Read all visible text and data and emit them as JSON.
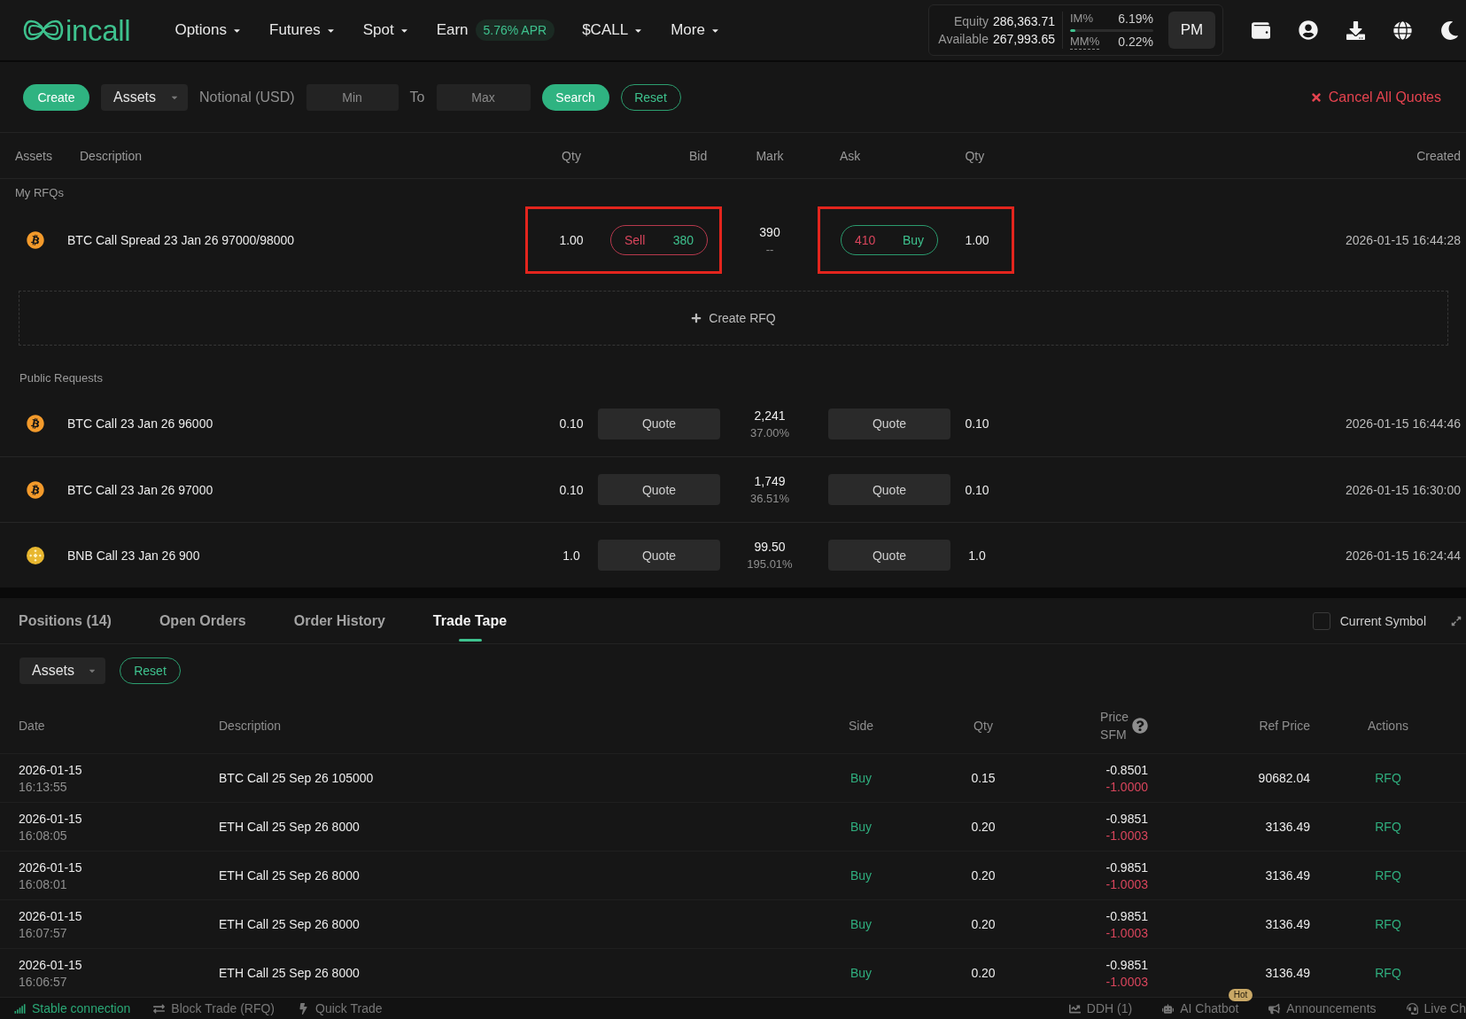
{
  "nav": {
    "logo": "incall",
    "menu": [
      {
        "label": "Options",
        "dropdown": true
      },
      {
        "label": "Futures",
        "dropdown": true
      },
      {
        "label": "Spot",
        "dropdown": true
      },
      {
        "label": "Earn",
        "dropdown": false,
        "badge": "5.76% APR"
      },
      {
        "label": "$CALL",
        "dropdown": true
      },
      {
        "label": "More",
        "dropdown": true
      }
    ],
    "account": {
      "equity_label": "Equity",
      "equity": "286,363.71",
      "available_label": "Available",
      "available": "267,993.65",
      "margins": [
        {
          "label": "IM%",
          "value": "6.19%",
          "tooltip": false,
          "level": 0.0619
        },
        {
          "label": "MM%",
          "value": "0.22%",
          "tooltip": true
        }
      ],
      "mode": "PM"
    }
  },
  "rfq_filters": {
    "create": "Create",
    "assets": "Assets",
    "notional_label": "Notional (USD)",
    "min": {
      "placeholder": "Min"
    },
    "to_label": "To",
    "max": {
      "placeholder": "Max"
    },
    "search": "Search",
    "reset": "Reset",
    "cancel_all": "Cancel All Quotes"
  },
  "rfq_table": {
    "columns": [
      "Assets",
      "Description",
      "Qty",
      "Bid",
      "Mark",
      "Ask",
      "Qty",
      "Created"
    ],
    "my_rfqs": {
      "title": "My RFQs",
      "rows": [
        {
          "kind": "btc",
          "description": "BTC Call Spread 23 Jan 26 97000/98000",
          "bid_qty": "1.00",
          "bid": {
            "side": "Sell",
            "price": "380",
            "highlighted": true
          },
          "mark": "390",
          "mark_sub": "--",
          "ask": {
            "price": "410",
            "side": "Buy",
            "highlighted": true
          },
          "ask_qty": "1.00",
          "created": "2026-01-15 16:44:28"
        }
      ],
      "create_label": "Create RFQ"
    },
    "public_requests": {
      "title": "Public Requests",
      "rows": [
        {
          "kind": "btc",
          "description": "BTC Call 23 Jan 26 96000",
          "bid_qty": "0.10",
          "bid_action": "Quote",
          "mark": "2,241",
          "mark_sub": "37.00%",
          "ask_action": "Quote",
          "ask_qty": "0.10",
          "created": "2026-01-15 16:44:46"
        },
        {
          "kind": "btc",
          "description": "BTC Call 23 Jan 26 97000",
          "bid_qty": "0.10",
          "bid_action": "Quote",
          "mark": "1,749",
          "mark_sub": "36.51%",
          "ask_action": "Quote",
          "ask_qty": "0.10",
          "created": "2026-01-15 16:30:00"
        },
        {
          "kind": "bnb",
          "description": "BNB Call 23 Jan 26 900",
          "bid_qty": "1.0",
          "bid_action": "Quote",
          "mark": "99.50",
          "mark_sub": "195.01%",
          "ask_action": "Quote",
          "ask_qty": "1.0",
          "created": "2026-01-15 16:24:44"
        }
      ]
    }
  },
  "positions_panel": {
    "tabs": [
      {
        "label": "Positions (14)",
        "selected": false
      },
      {
        "label": "Open Orders",
        "selected": false
      },
      {
        "label": "Order History",
        "selected": false
      },
      {
        "label": "Trade Tape",
        "selected": true
      }
    ],
    "current_symbol": {
      "label": "Current Symbol",
      "checked": false
    },
    "assets": "Assets",
    "reset": "Reset",
    "table": {
      "columns": [
        {
          "label": "Date"
        },
        {
          "label": "Description"
        },
        {
          "label": "Side"
        },
        {
          "label": "Qty"
        },
        {
          "label": "Price",
          "sublabel": "SFM",
          "help": true
        },
        {
          "label": "Ref Price"
        },
        {
          "label": "Actions"
        }
      ],
      "rows": [
        {
          "date": "2026-01-15",
          "time": "16:13:55",
          "description": "BTC Call 25 Sep 26 105000",
          "side": {
            "label": "Buy",
            "kind": "buy"
          },
          "qty": "0.15",
          "price": "-0.8501",
          "sfm": "-1.0000",
          "ref_price": "90682.04",
          "action": "RFQ"
        },
        {
          "date": "2026-01-15",
          "time": "16:08:05",
          "description": "ETH Call 25 Sep 26 8000",
          "side": {
            "label": "Buy",
            "kind": "buy"
          },
          "qty": "0.20",
          "price": "-0.9851",
          "sfm": "-1.0003",
          "ref_price": "3136.49",
          "action": "RFQ"
        },
        {
          "date": "2026-01-15",
          "time": "16:08:01",
          "description": "ETH Call 25 Sep 26 8000",
          "side": {
            "label": "Buy",
            "kind": "buy"
          },
          "qty": "0.20",
          "price": "-0.9851",
          "sfm": "-1.0003",
          "ref_price": "3136.49",
          "action": "RFQ"
        },
        {
          "date": "2026-01-15",
          "time": "16:07:57",
          "description": "ETH Call 25 Sep 26 8000",
          "side": {
            "label": "Buy",
            "kind": "buy"
          },
          "qty": "0.20",
          "price": "-0.9851",
          "sfm": "-1.0003",
          "ref_price": "3136.49",
          "action": "RFQ"
        },
        {
          "date": "2026-01-15",
          "time": "16:06:57",
          "description": "ETH Call 25 Sep 26 8000",
          "side": {
            "label": "Buy",
            "kind": "buy"
          },
          "qty": "0.20",
          "price": "-0.9851",
          "sfm": "-1.0003",
          "ref_price": "3136.49",
          "action": "RFQ"
        }
      ]
    }
  },
  "status_bar": {
    "left": [
      {
        "kind": "connection",
        "label": "Stable connection"
      },
      {
        "kind": "block_trade",
        "label": "Block Trade (RFQ)"
      },
      {
        "kind": "quick_trade",
        "label": "Quick Trade"
      }
    ],
    "right": [
      {
        "kind": "ddh",
        "label": "DDH (1)"
      },
      {
        "kind": "chatbot",
        "label": "AI Chatbot",
        "badge": "Hot"
      },
      {
        "kind": "announcements",
        "label": "Announcements"
      },
      {
        "kind": "live_chat",
        "label": "Live Ch"
      }
    ]
  }
}
